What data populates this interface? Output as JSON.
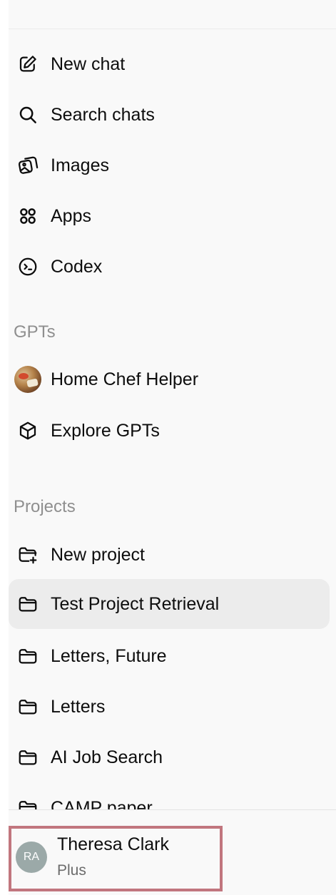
{
  "nav": {
    "items": [
      {
        "label": "New chat",
        "icon": "edit-icon"
      },
      {
        "label": "Search chats",
        "icon": "search-icon"
      },
      {
        "label": "Images",
        "icon": "images-icon"
      },
      {
        "label": "Apps",
        "icon": "apps-icon"
      },
      {
        "label": "Codex",
        "icon": "codex-icon"
      }
    ]
  },
  "gpts": {
    "heading": "GPTs",
    "items": [
      {
        "label": "Home Chef Helper",
        "icon": "home-chef-avatar"
      },
      {
        "label": "Explore GPTs",
        "icon": "cube-icon"
      }
    ]
  },
  "projects": {
    "heading": "Projects",
    "items": [
      {
        "label": "New project",
        "icon": "folder-plus-icon"
      },
      {
        "label": "Test Project Retrieval",
        "icon": "folder-icon",
        "active": true
      },
      {
        "label": "Letters, Future",
        "icon": "folder-icon"
      },
      {
        "label": "Letters",
        "icon": "folder-icon"
      },
      {
        "label": "AI Job Search",
        "icon": "folder-icon"
      },
      {
        "label": "CAMP paper",
        "icon": "folder-icon"
      }
    ]
  },
  "user": {
    "initials": "RA",
    "name": "Theresa Clark",
    "plan": "Plus"
  },
  "colors": {
    "sidebar_bg": "#f9f9f9",
    "active_bg": "#ececec",
    "highlight_border": "#c1767e",
    "avatar_bg": "#9ba9a8"
  }
}
